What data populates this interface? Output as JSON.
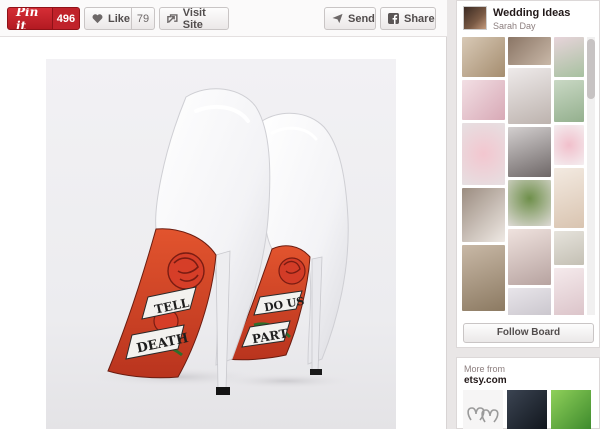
{
  "toolbar": {
    "pinit_label": "Pin it",
    "pinit_count": "496",
    "like_label": "Like",
    "like_count": "79",
    "visit_label": "Visit Site",
    "send_label": "Send",
    "share_label": "Share"
  },
  "photo": {
    "subject": "white patent stiletto heels with tattoo-painted soles",
    "sole_text_left": [
      "TELL",
      "DEATH"
    ],
    "sole_text_right": [
      "DO US",
      "PART"
    ]
  },
  "board": {
    "title": "Wedding Ideas",
    "user": "Sarah Day",
    "follow_label": "Follow Board"
  },
  "more": {
    "label": "More from",
    "source": "etsy.com"
  },
  "colors": {
    "pin_red": "#c0222a",
    "background": "#e9e6e6"
  }
}
